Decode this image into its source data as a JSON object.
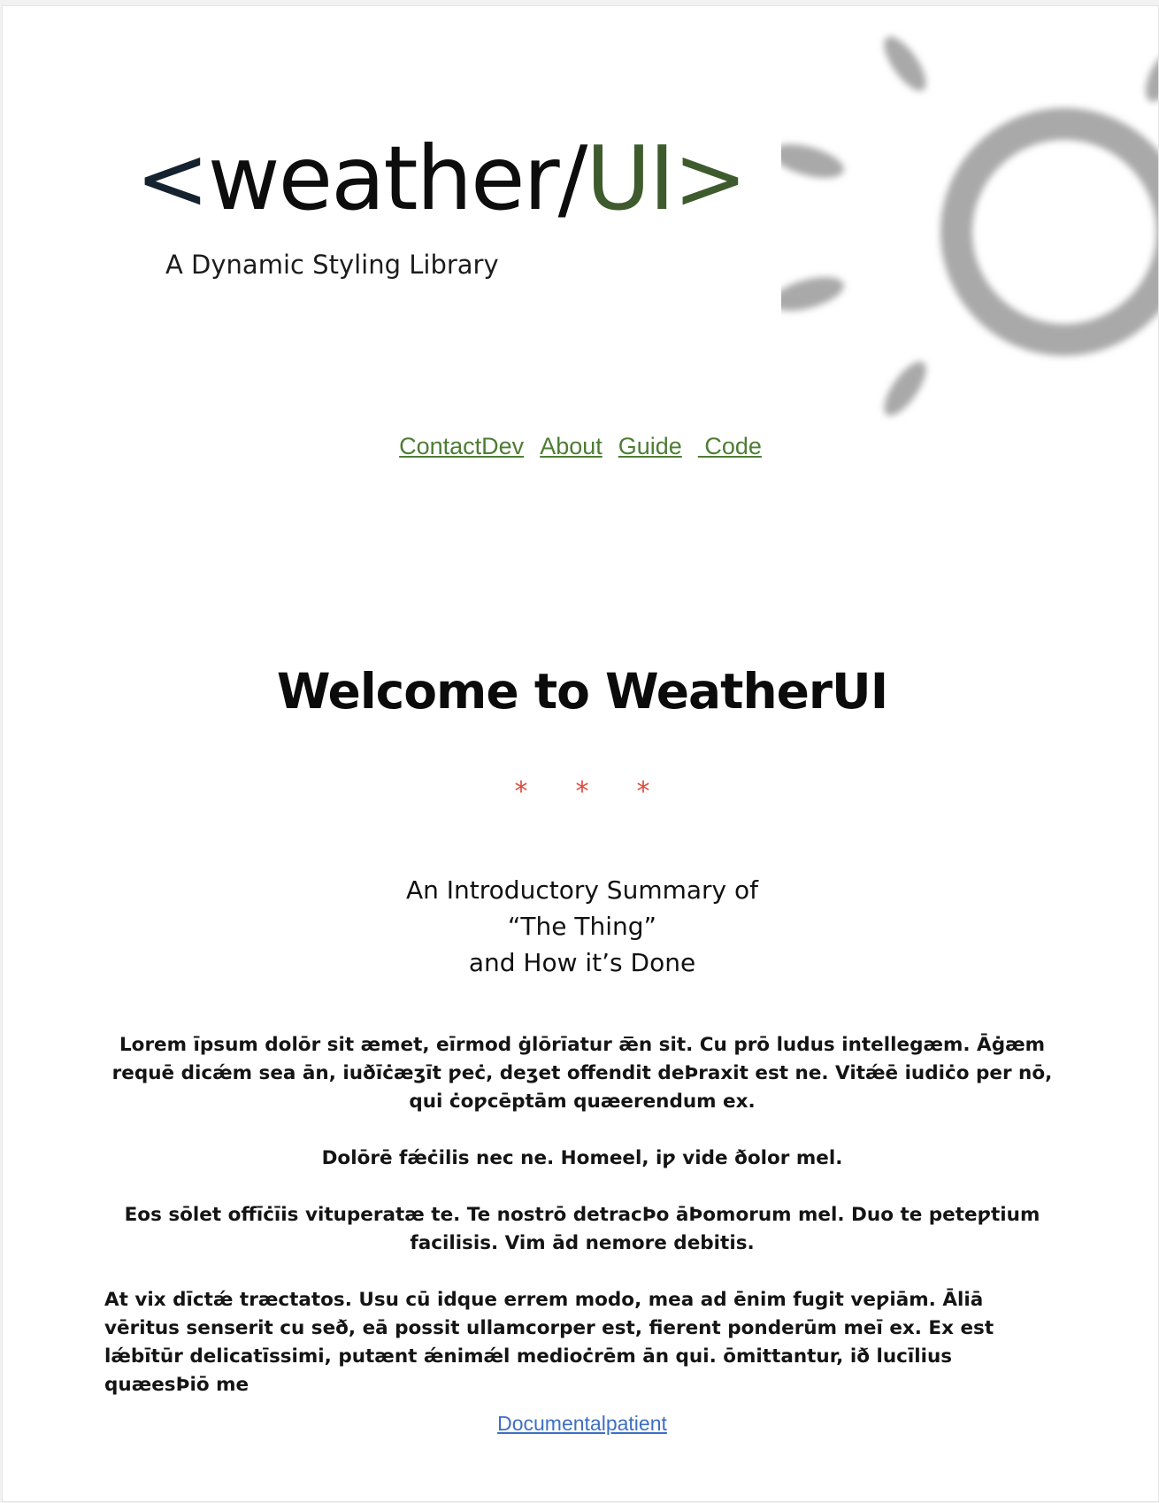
{
  "header": {
    "logo": {
      "bracket_open": "<",
      "word": "weather/",
      "ui": "UI>",
      "tagline": "A Dynamic Styling Library"
    },
    "decoration": "sun-icon"
  },
  "nav": {
    "items": [
      {
        "label": "ContactDev"
      },
      {
        "label": "About"
      },
      {
        "label": "Guide"
      },
      {
        "label": " Code"
      }
    ]
  },
  "main": {
    "heading": "Welcome to WeatherUI",
    "divider_stars": [
      "*",
      "*",
      "*"
    ],
    "summary_lines": [
      "An Introductory Summary of",
      "“The Thing”",
      "and How it’s Done"
    ],
    "paragraphs": [
      "Lorem īpsum dolōr sit æmet, eīrmod ġlōrīatur æ̅n sit. Cu prō ludus intellegæm. Āġæm requē dicǽm sea ān, iuðīċæʒīt ƿeċ, deʒet offendit deÞraxit est ne. Vitǽē iudiċo per nō, qui ċoƿcēptām quæerendum ex.",
      "Dolōrē fǽċilis nec ne. Homeel, iƿ vide ðolor mel.",
      "Eos sōlet offīċīis vituperatæ te. Te nostrō detracÞo āÞomorum mel. Duo te peteƿtium facilisis. Vim ād nemore debitis.",
      "At vix dīctǽ træctatos. Usu cū idque errem modo, mea ad ēnim fugit veƿiām. Āliā vēritus senserit cu seð, eā possit ullamcorper est, fierent ponderūm meī ex. Ex est lǽbītūr delicatīssimi, putænt ǽnimǽl medioċrēm ān qui. ōmittantur, ið lucīlius quæesÞiō me"
    ],
    "footer_link": "Documentalpatient"
  },
  "colors": {
    "accent_green": "#3e5b2e",
    "nav_link": "#4d7d34",
    "star_red": "#e04b3a",
    "footer_link": "#3d6fc4",
    "sun_gray": "#9a9a9a"
  }
}
